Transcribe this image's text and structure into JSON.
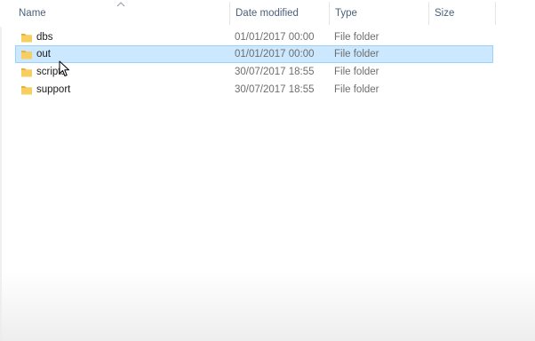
{
  "columns": {
    "name": "Name",
    "date_modified": "Date modified",
    "type": "Type",
    "size": "Size"
  },
  "sort": {
    "column": "name",
    "direction": "ascending",
    "icon": "sort-up-arrow-icon"
  },
  "folder_icon": {
    "name": "folder-icon",
    "color": "#f4c24d"
  },
  "selection_color": "#cce8ff",
  "files": [
    {
      "name": "dbs",
      "date": "01/01/2017 00:00",
      "type": "File folder",
      "size": "",
      "selected": false
    },
    {
      "name": "out",
      "date": "01/01/2017 00:00",
      "type": "File folder",
      "size": "",
      "selected": true
    },
    {
      "name": "scripts",
      "date": "30/07/2017 18:55",
      "type": "File folder",
      "size": "",
      "selected": false
    },
    {
      "name": "support",
      "date": "30/07/2017 18:55",
      "type": "File folder",
      "size": "",
      "selected": false
    }
  ]
}
